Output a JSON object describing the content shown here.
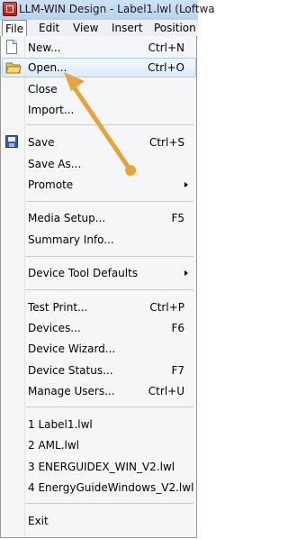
{
  "window": {
    "title": "LLM-WIN Design - Label1.lwl (Loftwa"
  },
  "menubar": [
    {
      "label": "File",
      "active": true
    },
    {
      "label": "Edit"
    },
    {
      "label": "View"
    },
    {
      "label": "Insert"
    },
    {
      "label": "Position"
    }
  ],
  "file_menu": [
    {
      "label": "New...",
      "shortcut": "Ctrl+N",
      "icon": "new-document-icon"
    },
    {
      "label": "Open...",
      "shortcut": "Ctrl+O",
      "icon": "open-folder-icon",
      "highlighted": true
    },
    {
      "label": "Close"
    },
    {
      "label": "Import..."
    },
    {
      "label": "Save",
      "shortcut": "Ctrl+S",
      "icon": "save-icon"
    },
    {
      "label": "Save As..."
    },
    {
      "label": "Promote",
      "submenu": true
    },
    {
      "label": "Media Setup...",
      "shortcut": "F5"
    },
    {
      "label": "Summary Info..."
    },
    {
      "label": "Device Tool Defaults",
      "submenu": true
    },
    {
      "label": "Test Print...",
      "shortcut": "Ctrl+P"
    },
    {
      "label": "Devices...",
      "shortcut": "F6"
    },
    {
      "label": "Device Wizard..."
    },
    {
      "label": "Device Status...",
      "shortcut": "F7"
    },
    {
      "label": "Manage Users...",
      "shortcut": "Ctrl+U"
    },
    {
      "label": "1 Label1.lwl"
    },
    {
      "label": "2 AML.lwl"
    },
    {
      "label": "3 ENERGUIDEX_WIN_V2.lwl"
    },
    {
      "label": "4 EnergyGuideWindows_V2.lwl"
    },
    {
      "label": "Exit"
    }
  ],
  "colors": {
    "annotation_arrow": "#e8a33a",
    "highlight_border": "#aeccea"
  }
}
